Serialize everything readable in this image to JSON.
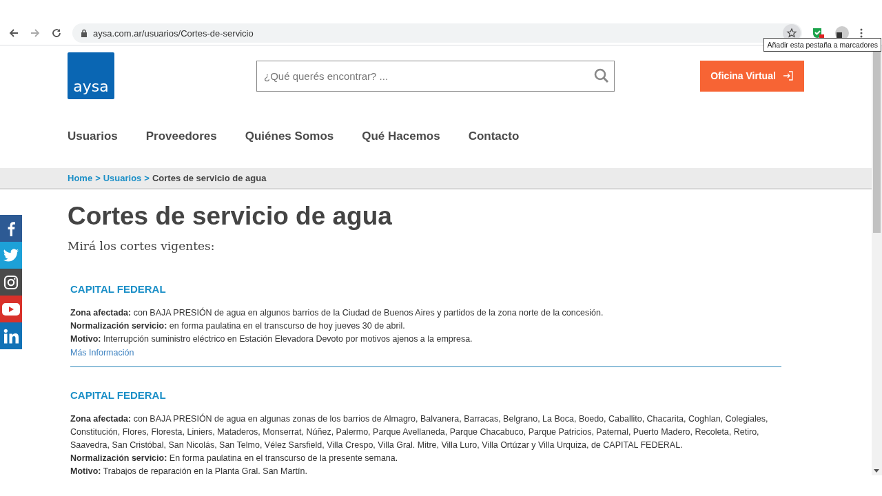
{
  "browser": {
    "url": "aysa.com.ar/usuarios/Cortes-de-servicio",
    "tooltip": "Añadir esta pestaña a marcadores"
  },
  "header": {
    "logo": "aysa",
    "search": {
      "placeholder": "¿Qué querés encontrar? ..."
    },
    "cta": "Oficina Virtual"
  },
  "nav": [
    "Usuarios",
    "Proveedores",
    "Quiénes Somos",
    "Qué Hacemos",
    "Contacto"
  ],
  "breadcrumb": [
    {
      "kind": "link",
      "label": "Home"
    },
    {
      "kind": "separator",
      "label": ">"
    },
    {
      "kind": "link",
      "label": "Usuarios"
    },
    {
      "kind": "separator",
      "label": ">"
    },
    {
      "kind": "current",
      "label": "Cortes de servicio de agua"
    }
  ],
  "title": "Cortes de servicio de agua",
  "subtitle": "Mirá los cortes vigentes:",
  "notices": [
    {
      "region": "CAPITAL FEDERAL",
      "lines": [
        "**Zona afectada:** con BAJA PRESIÓN de agua en algunos barrios de la Ciudad de Buenos Aires y partidos de la zona norte de la concesión.",
        "**Normalización servicio:** en forma paulatina en el transcurso de hoy jueves 30 de abril.",
        "**Motivo:** Interrupción suministro eléctrico en Estación Elevadora Devoto por motivos ajenos a la empresa."
      ],
      "link": "Más Información"
    },
    {
      "region": "CAPITAL FEDERAL",
      "lines": [
        "**Zona afectada:** con BAJA PRESIÓN de agua en algunas zonas de los barrios de Almagro, Balvanera, Barracas, Belgrano, La Boca, Boedo, Caballito, Chacarita, Coghlan, Colegiales, Constitución, Flores, Floresta, Liniers, Mataderos, Monserrat, Núñez, Palermo, Parque Avellaneda, Parque Chacabuco, Parque Patricios, Paternal, Puerto Madero, Recoleta, Retiro, Saavedra, San Cristóbal, San Nicolás, San Telmo, Vélez Sarsfield, Villa Crespo, Villa Gral. Mitre, Villa Luro, Villa Ortúzar y Villa Urquiza, de CAPITAL FEDERAL.",
        "**Normalización servicio:** En forma paulatina en el transcurso de la presente semana.",
        "**Motivo:** Trabajos de reparación en la Planta Gral. San Martín."
      ]
    }
  ],
  "social": [
    {
      "kind": "facebook",
      "color": "#2d5a94"
    },
    {
      "kind": "twitter",
      "color": "#1da1d8"
    },
    {
      "kind": "instagram",
      "color": "#4a4a4a"
    },
    {
      "kind": "youtube",
      "color": "#d8312a"
    },
    {
      "kind": "linkedin",
      "color": "#1272b6"
    }
  ]
}
